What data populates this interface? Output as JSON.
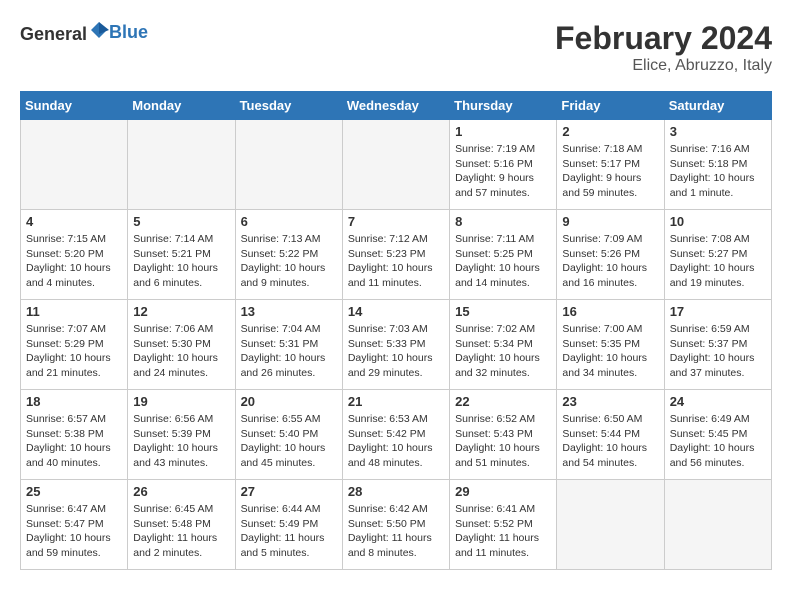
{
  "header": {
    "logo_general": "General",
    "logo_blue": "Blue",
    "month_year": "February 2024",
    "location": "Elice, Abruzzo, Italy"
  },
  "days_of_week": [
    "Sunday",
    "Monday",
    "Tuesday",
    "Wednesday",
    "Thursday",
    "Friday",
    "Saturday"
  ],
  "weeks": [
    [
      {
        "day": "",
        "info": ""
      },
      {
        "day": "",
        "info": ""
      },
      {
        "day": "",
        "info": ""
      },
      {
        "day": "",
        "info": ""
      },
      {
        "day": "1",
        "info": "Sunrise: 7:19 AM\nSunset: 5:16 PM\nDaylight: 9 hours\nand 57 minutes."
      },
      {
        "day": "2",
        "info": "Sunrise: 7:18 AM\nSunset: 5:17 PM\nDaylight: 9 hours\nand 59 minutes."
      },
      {
        "day": "3",
        "info": "Sunrise: 7:16 AM\nSunset: 5:18 PM\nDaylight: 10 hours\nand 1 minute."
      }
    ],
    [
      {
        "day": "4",
        "info": "Sunrise: 7:15 AM\nSunset: 5:20 PM\nDaylight: 10 hours\nand 4 minutes."
      },
      {
        "day": "5",
        "info": "Sunrise: 7:14 AM\nSunset: 5:21 PM\nDaylight: 10 hours\nand 6 minutes."
      },
      {
        "day": "6",
        "info": "Sunrise: 7:13 AM\nSunset: 5:22 PM\nDaylight: 10 hours\nand 9 minutes."
      },
      {
        "day": "7",
        "info": "Sunrise: 7:12 AM\nSunset: 5:23 PM\nDaylight: 10 hours\nand 11 minutes."
      },
      {
        "day": "8",
        "info": "Sunrise: 7:11 AM\nSunset: 5:25 PM\nDaylight: 10 hours\nand 14 minutes."
      },
      {
        "day": "9",
        "info": "Sunrise: 7:09 AM\nSunset: 5:26 PM\nDaylight: 10 hours\nand 16 minutes."
      },
      {
        "day": "10",
        "info": "Sunrise: 7:08 AM\nSunset: 5:27 PM\nDaylight: 10 hours\nand 19 minutes."
      }
    ],
    [
      {
        "day": "11",
        "info": "Sunrise: 7:07 AM\nSunset: 5:29 PM\nDaylight: 10 hours\nand 21 minutes."
      },
      {
        "day": "12",
        "info": "Sunrise: 7:06 AM\nSunset: 5:30 PM\nDaylight: 10 hours\nand 24 minutes."
      },
      {
        "day": "13",
        "info": "Sunrise: 7:04 AM\nSunset: 5:31 PM\nDaylight: 10 hours\nand 26 minutes."
      },
      {
        "day": "14",
        "info": "Sunrise: 7:03 AM\nSunset: 5:33 PM\nDaylight: 10 hours\nand 29 minutes."
      },
      {
        "day": "15",
        "info": "Sunrise: 7:02 AM\nSunset: 5:34 PM\nDaylight: 10 hours\nand 32 minutes."
      },
      {
        "day": "16",
        "info": "Sunrise: 7:00 AM\nSunset: 5:35 PM\nDaylight: 10 hours\nand 34 minutes."
      },
      {
        "day": "17",
        "info": "Sunrise: 6:59 AM\nSunset: 5:37 PM\nDaylight: 10 hours\nand 37 minutes."
      }
    ],
    [
      {
        "day": "18",
        "info": "Sunrise: 6:57 AM\nSunset: 5:38 PM\nDaylight: 10 hours\nand 40 minutes."
      },
      {
        "day": "19",
        "info": "Sunrise: 6:56 AM\nSunset: 5:39 PM\nDaylight: 10 hours\nand 43 minutes."
      },
      {
        "day": "20",
        "info": "Sunrise: 6:55 AM\nSunset: 5:40 PM\nDaylight: 10 hours\nand 45 minutes."
      },
      {
        "day": "21",
        "info": "Sunrise: 6:53 AM\nSunset: 5:42 PM\nDaylight: 10 hours\nand 48 minutes."
      },
      {
        "day": "22",
        "info": "Sunrise: 6:52 AM\nSunset: 5:43 PM\nDaylight: 10 hours\nand 51 minutes."
      },
      {
        "day": "23",
        "info": "Sunrise: 6:50 AM\nSunset: 5:44 PM\nDaylight: 10 hours\nand 54 minutes."
      },
      {
        "day": "24",
        "info": "Sunrise: 6:49 AM\nSunset: 5:45 PM\nDaylight: 10 hours\nand 56 minutes."
      }
    ],
    [
      {
        "day": "25",
        "info": "Sunrise: 6:47 AM\nSunset: 5:47 PM\nDaylight: 10 hours\nand 59 minutes."
      },
      {
        "day": "26",
        "info": "Sunrise: 6:45 AM\nSunset: 5:48 PM\nDaylight: 11 hours\nand 2 minutes."
      },
      {
        "day": "27",
        "info": "Sunrise: 6:44 AM\nSunset: 5:49 PM\nDaylight: 11 hours\nand 5 minutes."
      },
      {
        "day": "28",
        "info": "Sunrise: 6:42 AM\nSunset: 5:50 PM\nDaylight: 11 hours\nand 8 minutes."
      },
      {
        "day": "29",
        "info": "Sunrise: 6:41 AM\nSunset: 5:52 PM\nDaylight: 11 hours\nand 11 minutes."
      },
      {
        "day": "",
        "info": ""
      },
      {
        "day": "",
        "info": ""
      }
    ]
  ]
}
